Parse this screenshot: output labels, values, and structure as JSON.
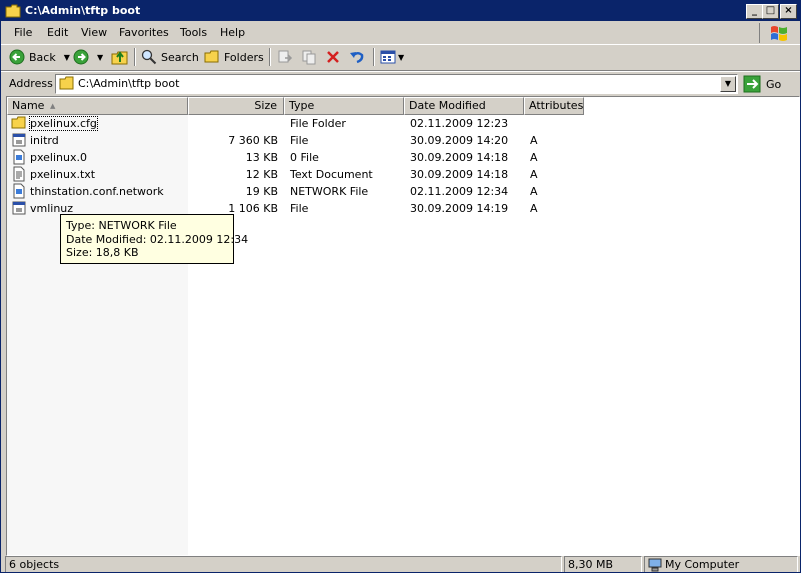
{
  "window": {
    "title": "C:\\Admin\\tftp boot",
    "controls": [
      "_",
      "□",
      "×"
    ]
  },
  "menu": {
    "items": [
      "File",
      "Edit",
      "View",
      "Favorites",
      "Tools",
      "Help"
    ]
  },
  "toolbar": {
    "back_label": "Back",
    "search_label": "Search",
    "folders_label": "Folders"
  },
  "address": {
    "label": "Address",
    "value": "C:\\Admin\\tftp boot",
    "go_label": "Go"
  },
  "list": {
    "columns": {
      "name": "Name",
      "size": "Size",
      "type": "Type",
      "modified": "Date Modified",
      "attributes": "Attributes"
    },
    "rows": [
      {
        "name": "pxelinux.cfg",
        "size": "",
        "type": "File Folder",
        "modified": "02.11.2009 12:23",
        "attr": "",
        "icon": "folder-icon"
      },
      {
        "name": "initrd",
        "size": "7 360 KB",
        "type": "File",
        "modified": "30.09.2009 14:20",
        "attr": "A",
        "icon": "file-icon"
      },
      {
        "name": "pxelinux.0",
        "size": "13 KB",
        "type": "0 File",
        "modified": "30.09.2009 14:18",
        "attr": "A",
        "icon": "document-icon"
      },
      {
        "name": "pxelinux.txt",
        "size": "12 KB",
        "type": "Text Document",
        "modified": "30.09.2009 14:18",
        "attr": "A",
        "icon": "text-document-icon"
      },
      {
        "name": "thinstation.conf.network",
        "size": "19 KB",
        "type": "NETWORK File",
        "modified": "02.11.2009 12:34",
        "attr": "A",
        "icon": "document-icon"
      },
      {
        "name": "vmlinuz",
        "size": "1 106 KB",
        "type": "File",
        "modified": "30.09.2009 14:19",
        "attr": "A",
        "icon": "file-icon"
      }
    ]
  },
  "tooltip": {
    "type_line": "Type: NETWORK File",
    "date_line": "Date Modified: 02.11.2009 12:34",
    "size_line": "Size: 18,8 KB"
  },
  "status": {
    "objects": "6 objects",
    "size": "8,30 MB",
    "zone": "My Computer"
  },
  "colors": {
    "titlebar": "#0a246a",
    "face": "#d4d0c8",
    "tooltip": "#ffffe1"
  }
}
